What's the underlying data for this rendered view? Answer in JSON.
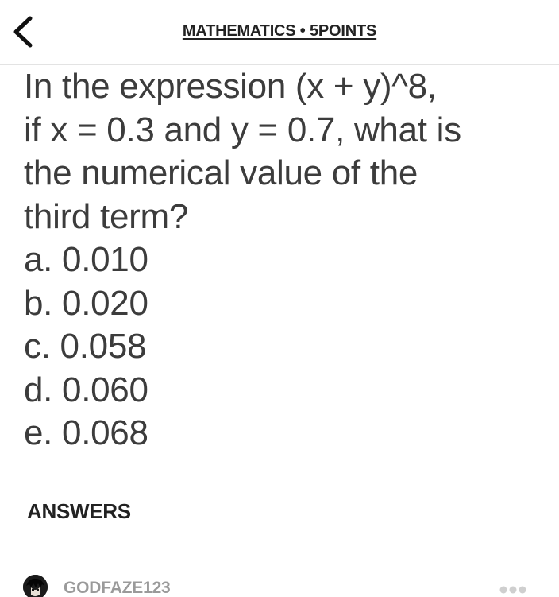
{
  "header": {
    "title": "MATHEMATICS • 5POINTS",
    "back_icon": "chevron-left-icon"
  },
  "question": {
    "lines": [
      "In the expression (x + y)^8,",
      "if x = 0.3 and y = 0.7, what is",
      "the numerical value of the",
      "third term?"
    ],
    "options": [
      "a. 0.010",
      "b. 0.020",
      "c. 0.058",
      "d. 0.060",
      "e. 0.068"
    ]
  },
  "answers": {
    "section_title": "ANSWERS",
    "items": [
      {
        "username": "GODFAZE123",
        "more_icon": "more-dots-icon"
      }
    ]
  },
  "colors": {
    "text": "#3c3c3c",
    "heading": "#222222",
    "muted": "#9a9a9a",
    "divider": "#ececec"
  }
}
